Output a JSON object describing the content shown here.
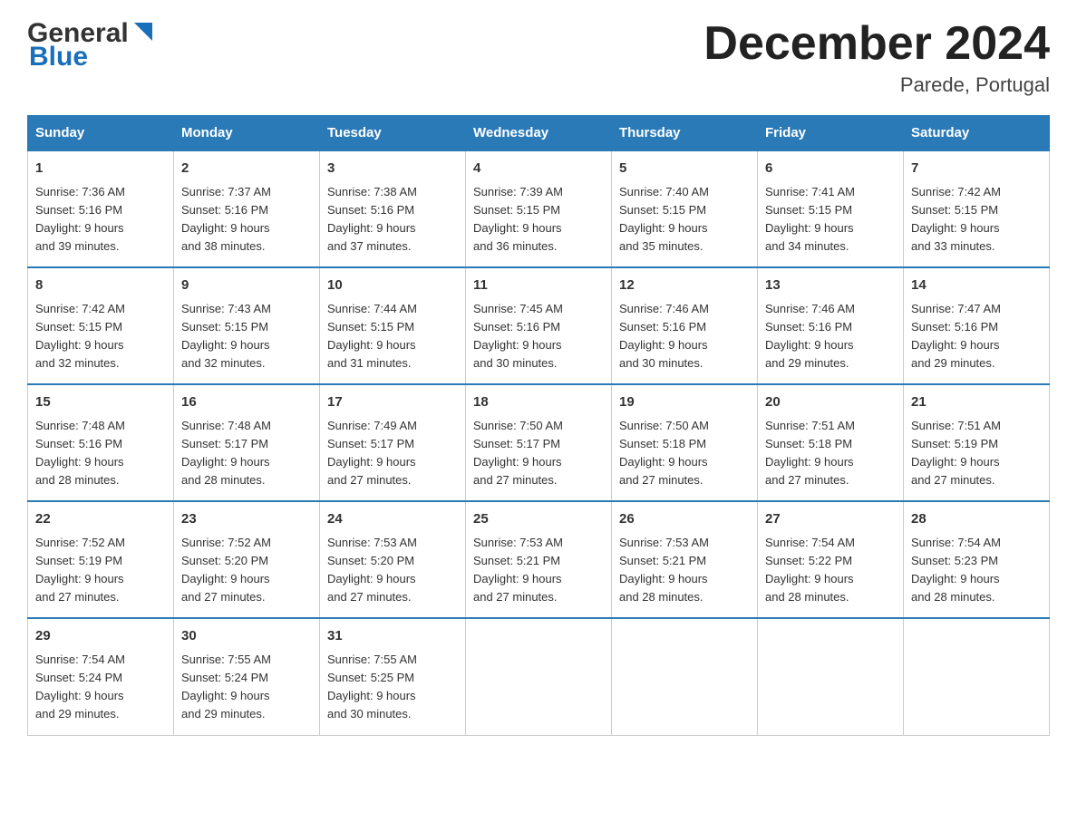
{
  "logo": {
    "general": "General",
    "blue": "Blue"
  },
  "title": "December 2024",
  "subtitle": "Parede, Portugal",
  "days_of_week": [
    "Sunday",
    "Monday",
    "Tuesday",
    "Wednesday",
    "Thursday",
    "Friday",
    "Saturday"
  ],
  "weeks": [
    [
      {
        "day": "1",
        "sunrise": "7:36 AM",
        "sunset": "5:16 PM",
        "daylight": "9 hours and 39 minutes."
      },
      {
        "day": "2",
        "sunrise": "7:37 AM",
        "sunset": "5:16 PM",
        "daylight": "9 hours and 38 minutes."
      },
      {
        "day": "3",
        "sunrise": "7:38 AM",
        "sunset": "5:16 PM",
        "daylight": "9 hours and 37 minutes."
      },
      {
        "day": "4",
        "sunrise": "7:39 AM",
        "sunset": "5:15 PM",
        "daylight": "9 hours and 36 minutes."
      },
      {
        "day": "5",
        "sunrise": "7:40 AM",
        "sunset": "5:15 PM",
        "daylight": "9 hours and 35 minutes."
      },
      {
        "day": "6",
        "sunrise": "7:41 AM",
        "sunset": "5:15 PM",
        "daylight": "9 hours and 34 minutes."
      },
      {
        "day": "7",
        "sunrise": "7:42 AM",
        "sunset": "5:15 PM",
        "daylight": "9 hours and 33 minutes."
      }
    ],
    [
      {
        "day": "8",
        "sunrise": "7:42 AM",
        "sunset": "5:15 PM",
        "daylight": "9 hours and 32 minutes."
      },
      {
        "day": "9",
        "sunrise": "7:43 AM",
        "sunset": "5:15 PM",
        "daylight": "9 hours and 32 minutes."
      },
      {
        "day": "10",
        "sunrise": "7:44 AM",
        "sunset": "5:15 PM",
        "daylight": "9 hours and 31 minutes."
      },
      {
        "day": "11",
        "sunrise": "7:45 AM",
        "sunset": "5:16 PM",
        "daylight": "9 hours and 30 minutes."
      },
      {
        "day": "12",
        "sunrise": "7:46 AM",
        "sunset": "5:16 PM",
        "daylight": "9 hours and 30 minutes."
      },
      {
        "day": "13",
        "sunrise": "7:46 AM",
        "sunset": "5:16 PM",
        "daylight": "9 hours and 29 minutes."
      },
      {
        "day": "14",
        "sunrise": "7:47 AM",
        "sunset": "5:16 PM",
        "daylight": "9 hours and 29 minutes."
      }
    ],
    [
      {
        "day": "15",
        "sunrise": "7:48 AM",
        "sunset": "5:16 PM",
        "daylight": "9 hours and 28 minutes."
      },
      {
        "day": "16",
        "sunrise": "7:48 AM",
        "sunset": "5:17 PM",
        "daylight": "9 hours and 28 minutes."
      },
      {
        "day": "17",
        "sunrise": "7:49 AM",
        "sunset": "5:17 PM",
        "daylight": "9 hours and 27 minutes."
      },
      {
        "day": "18",
        "sunrise": "7:50 AM",
        "sunset": "5:17 PM",
        "daylight": "9 hours and 27 minutes."
      },
      {
        "day": "19",
        "sunrise": "7:50 AM",
        "sunset": "5:18 PM",
        "daylight": "9 hours and 27 minutes."
      },
      {
        "day": "20",
        "sunrise": "7:51 AM",
        "sunset": "5:18 PM",
        "daylight": "9 hours and 27 minutes."
      },
      {
        "day": "21",
        "sunrise": "7:51 AM",
        "sunset": "5:19 PM",
        "daylight": "9 hours and 27 minutes."
      }
    ],
    [
      {
        "day": "22",
        "sunrise": "7:52 AM",
        "sunset": "5:19 PM",
        "daylight": "9 hours and 27 minutes."
      },
      {
        "day": "23",
        "sunrise": "7:52 AM",
        "sunset": "5:20 PM",
        "daylight": "9 hours and 27 minutes."
      },
      {
        "day": "24",
        "sunrise": "7:53 AM",
        "sunset": "5:20 PM",
        "daylight": "9 hours and 27 minutes."
      },
      {
        "day": "25",
        "sunrise": "7:53 AM",
        "sunset": "5:21 PM",
        "daylight": "9 hours and 27 minutes."
      },
      {
        "day": "26",
        "sunrise": "7:53 AM",
        "sunset": "5:21 PM",
        "daylight": "9 hours and 28 minutes."
      },
      {
        "day": "27",
        "sunrise": "7:54 AM",
        "sunset": "5:22 PM",
        "daylight": "9 hours and 28 minutes."
      },
      {
        "day": "28",
        "sunrise": "7:54 AM",
        "sunset": "5:23 PM",
        "daylight": "9 hours and 28 minutes."
      }
    ],
    [
      {
        "day": "29",
        "sunrise": "7:54 AM",
        "sunset": "5:24 PM",
        "daylight": "9 hours and 29 minutes."
      },
      {
        "day": "30",
        "sunrise": "7:55 AM",
        "sunset": "5:24 PM",
        "daylight": "9 hours and 29 minutes."
      },
      {
        "day": "31",
        "sunrise": "7:55 AM",
        "sunset": "5:25 PM",
        "daylight": "9 hours and 30 minutes."
      },
      null,
      null,
      null,
      null
    ]
  ],
  "labels": {
    "sunrise": "Sunrise:",
    "sunset": "Sunset:",
    "daylight": "Daylight:"
  }
}
